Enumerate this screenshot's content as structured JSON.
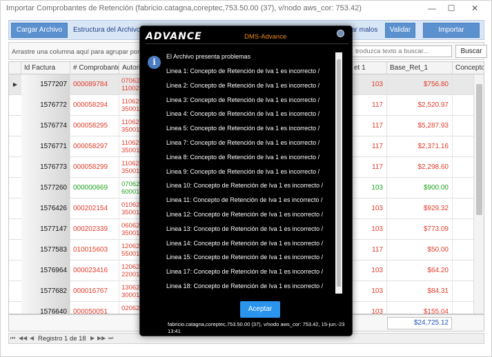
{
  "window": {
    "title": "Importar Comprobantes de Retención  (fabricio.catagna,coreptec,753.50.00 (37), v/nodo aws_cor: 753.42)",
    "minimize": "—",
    "maximize": "☐",
    "close": "✕"
  },
  "toolbar": {
    "cargar_archivo": "Cargar Archivo",
    "estructura_archivo": "Estructura del Archivo",
    "mostrar_malos": "ar malos",
    "validar": "Validar",
    "importar": "Importar"
  },
  "group_bar": {
    "hint": "Arrastre una columna aquí para agrupar por dich",
    "search_placeholder": "troduzca texto a buscar...",
    "buscar": "Buscar"
  },
  "grid": {
    "columns": [
      "Id Factura",
      "# Comprobante",
      "Autori",
      "et 1",
      "Base_Ret_1",
      "Concepto"
    ],
    "rows": [
      {
        "id": "1577207",
        "comp": "000089784",
        "aut1": "07062",
        "aut2": "11002",
        "ret": "103",
        "base": "$756.80",
        "color": "red"
      },
      {
        "id": "1576772",
        "comp": "000058294",
        "aut1": "11062",
        "aut2": "35001",
        "ret": "117",
        "base": "$2,520.97",
        "color": "red"
      },
      {
        "id": "1576774",
        "comp": "000058295",
        "aut1": "11062",
        "aut2": "35001",
        "ret": "117",
        "base": "$5,287.93",
        "color": "red"
      },
      {
        "id": "1576771",
        "comp": "000058297",
        "aut1": "11062",
        "aut2": "35001",
        "ret": "117",
        "base": "$2,371.16",
        "color": "red"
      },
      {
        "id": "1576773",
        "comp": "000058299",
        "aut1": "11062",
        "aut2": "35001",
        "ret": "117",
        "base": "$2,298.60",
        "color": "red"
      },
      {
        "id": "1577260",
        "comp": "000000669",
        "aut1": "07062",
        "aut2": "60001",
        "ret": "103",
        "base": "$900.00",
        "color": "green"
      },
      {
        "id": "1576426",
        "comp": "000202154",
        "aut1": "01062",
        "aut2": "35001",
        "ret": "103",
        "base": "$929.32",
        "color": "red"
      },
      {
        "id": "1577147",
        "comp": "000202339",
        "aut1": "06062",
        "aut2": "35001",
        "ret": "103",
        "base": "$773.09",
        "color": "red"
      },
      {
        "id": "1577583",
        "comp": "010015603",
        "aut1": "12062",
        "aut2": "55001",
        "ret": "117",
        "base": "$50.00",
        "color": "red"
      },
      {
        "id": "1576964",
        "comp": "000023416",
        "aut1": "12062",
        "aut2": "22001",
        "ret": "103",
        "base": "$64.20",
        "color": "red"
      },
      {
        "id": "1577682",
        "comp": "000016767",
        "aut1": "13062",
        "aut2": "30001",
        "ret": "103",
        "base": "$84.31",
        "color": "red"
      },
      {
        "id": "1576640",
        "comp": "000050051",
        "aut1": "02062",
        "aut2": "",
        "ret": "103",
        "base": "$155.04",
        "color": "red"
      }
    ],
    "total": "$24,725.12"
  },
  "nav": {
    "first": "⏮",
    "prev_page": "◀◀",
    "prev": "◀",
    "record": "Registro 1 de 18",
    "next": "▶",
    "next_page": "▶▶",
    "last": "⏭"
  },
  "modal": {
    "logo": "ADVANCE",
    "title": "DMS-Advance",
    "header": "El Archivo presenta problemas",
    "lines": [
      "Linea 1: Concepto de Retención de Iva 1 es incorrecto /",
      "Linea 2: Concepto de Retención de Iva 1 es incorrecto /",
      "Linea 3: Concepto de Retención de Iva 1 es incorrecto /",
      "Linea 4: Concepto de Retención de Iva 1 es incorrecto /",
      "Linea 5: Concepto de Retención de Iva 1 es incorrecto /",
      "Linea 7: Concepto de Retención de Iva 1 es incorrecto /",
      "Linea 8: Concepto de Retención de Iva 1 es incorrecto /",
      "Linea 9: Concepto de Retención de Iva 1 es incorrecto /",
      "Linea 10: Concepto de Retención de Iva 1 es incorrecto /",
      "Linea 11: Concepto de Retención de Iva 1 es incorrecto /",
      "Linea 12: Concepto de Retención de Iva 1 es incorrecto /",
      "Linea 13: Concepto de Retención de Iva 1 es incorrecto /",
      "Linea 14: Concepto de Retención de Iva 1 es incorrecto /",
      "Linea 15: Concepto de Retención de Iva 1 es incorrecto /",
      "Linea 17: Concepto de Retención de Iva 1 es incorrecto /",
      "Linea 18: Concepto de Retención de Iva 1 es incorrecto /"
    ],
    "accept": "Aceptar",
    "footer": "fabricio.catagna,coreptec,753.50.00 (37), v/nodo aws_cor: 753.42, 15-jun.-23 13:41"
  }
}
